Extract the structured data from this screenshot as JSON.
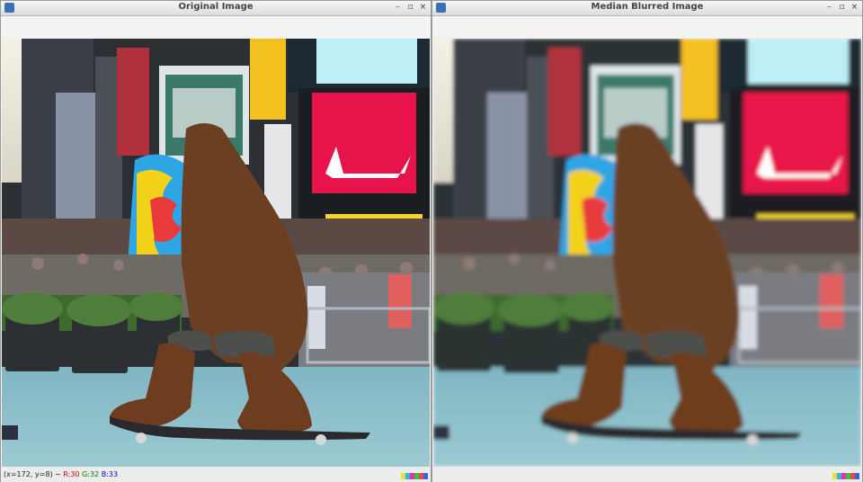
{
  "windows": {
    "left": {
      "title": "Original Image",
      "status": {
        "coords": "(x=172, y=8) ~ ",
        "r": "R:30",
        "g": "G:32",
        "b": "B:33"
      }
    },
    "right": {
      "title": "Median Blurred Image"
    }
  },
  "controls": {
    "close": "×",
    "minimize": "–",
    "maximize": "▫"
  },
  "colors": {
    "swatches": [
      "#e8e236",
      "#38b1e8",
      "#e830b0",
      "#35c44a",
      "#ea4b3c",
      "#3860e8"
    ]
  }
}
